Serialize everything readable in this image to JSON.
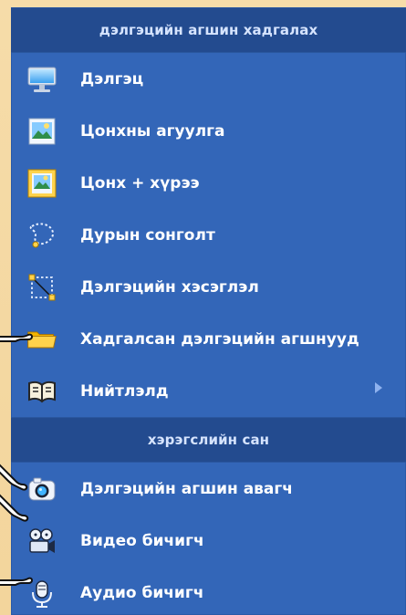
{
  "menu": {
    "section1_title": "дэлгэцийн агшин хадгалах",
    "section2_title": "хэрэгслийн сан",
    "items": [
      {
        "label": "Дэлгэц",
        "icon": "monitor-icon"
      },
      {
        "label": "Цонхны агуулга",
        "icon": "window-content-icon"
      },
      {
        "label": "Цонх + хүрээ",
        "icon": "window-frame-icon"
      },
      {
        "label": "Дурын сонголт",
        "icon": "freeform-selection-icon"
      },
      {
        "label": "Дэлгэцийн хэсэглэл",
        "icon": "region-selection-icon"
      },
      {
        "label": "Хадгалсан дэлгэцийн агшнууд",
        "icon": "folder-icon"
      },
      {
        "label": "Нийтлэлд",
        "icon": "publish-icon",
        "submenu_icon": "chevron-right-icon"
      }
    ],
    "tools": [
      {
        "label": "Дэлгэцийн агшин авагч",
        "icon": "camera-icon"
      },
      {
        "label": "Видео бичигч",
        "icon": "video-camera-icon"
      },
      {
        "label": "Аудио бичигч",
        "icon": "microphone-icon"
      }
    ]
  },
  "theme": {
    "menu_bg": "#3366b8",
    "header_bg": "#234b8f",
    "page_bg": "#f4d7a0",
    "text": "#ffffff"
  }
}
